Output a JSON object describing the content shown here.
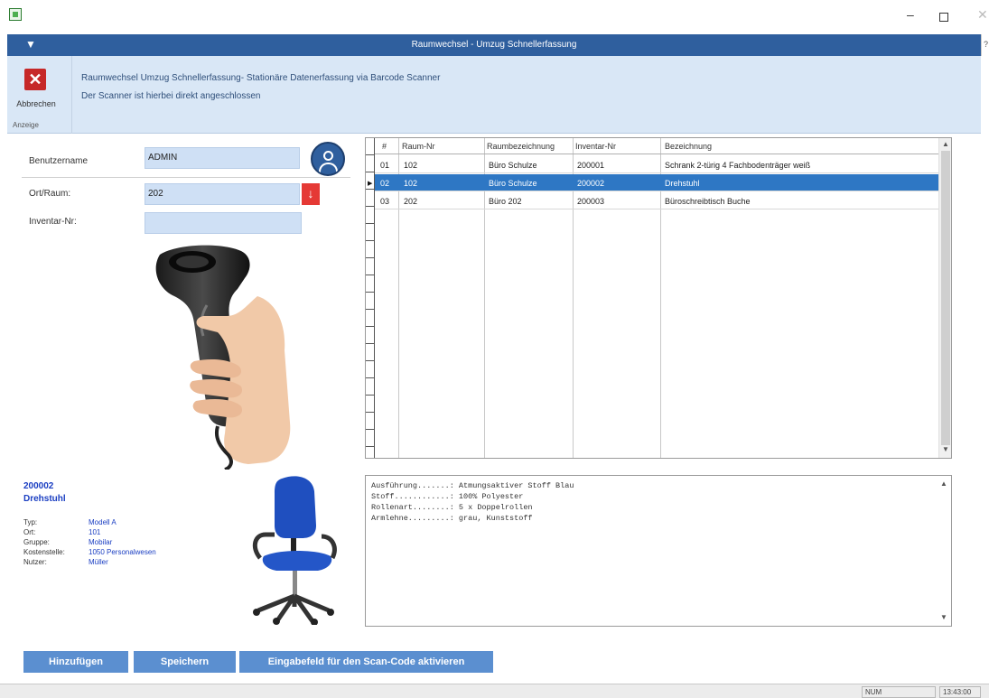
{
  "window": {
    "title": "Raumwechsel - Umzug Schnellerfassung",
    "minimize": "–",
    "close": "✕",
    "menu_glyph": "▼",
    "edge_glyph": "?"
  },
  "ribbon": {
    "cancel_label": "Abbrechen",
    "group_label": "Anzeige",
    "line1": "Raumwechsel Umzug Schnellerfassung-  Stationäre Datenerfassung via Barcode Scanner",
    "line2": "Der Scanner ist hierbei direkt angeschlossen"
  },
  "form": {
    "username_label": "Benutzername",
    "username_value": "ADMIN",
    "room_label": "Ort/Raum:",
    "room_value": "202",
    "inventory_label": "Inventar-Nr:",
    "inventory_value": ""
  },
  "grid": {
    "headers": [
      "#",
      "Raum-Nr",
      "Raumbezeichnung",
      "Inventar-Nr",
      "Bezeichnung"
    ],
    "rows": [
      {
        "nr": "01",
        "room": "102",
        "room_name": "Büro Schulze",
        "inventory": "200001",
        "designation": "Schrank 2-türig 4 Fachbodenträger weiß",
        "selected": false
      },
      {
        "nr": "02",
        "room": "102",
        "room_name": "Büro Schulze",
        "inventory": "200002",
        "designation": "Drehstuhl",
        "selected": true
      },
      {
        "nr": "03",
        "room": "202",
        "room_name": "Büro 202",
        "inventory": "200003",
        "designation": "Büroschreibtisch Buche",
        "selected": false
      }
    ],
    "selection_color": "#2e77c4"
  },
  "item": {
    "id": "200002",
    "name": "Drehstuhl",
    "properties": [
      {
        "key": "Typ:",
        "value": "Modell A"
      },
      {
        "key": "Ort:",
        "value": "101"
      },
      {
        "key": "Gruppe:",
        "value": "Mobilar"
      },
      {
        "key": "Kostenstelle:",
        "value": "1050 Personalwesen"
      },
      {
        "key": "Nutzer:",
        "value": "Müller"
      }
    ]
  },
  "detail": {
    "lines": [
      "Ausführung.......: Atmungsaktiver Stoff Blau",
      "Stoff............: 100% Polyester",
      "Rollenart........: 5 x Doppelrollen",
      "Armlehne.........: grau, Kunststoff"
    ]
  },
  "actions": {
    "add_label": "Hinzufügen",
    "save_label": "Speichern",
    "scan_label": "Eingabefeld für den Scan-Code aktivieren"
  },
  "status": {
    "num": "NUM",
    "time": "13:43:00"
  },
  "icons": {
    "app": "spreadsheet-app-icon",
    "cancel": "close-x-icon",
    "user": "user-avatar-icon",
    "room_arrow": "arrow-down-icon"
  },
  "colors": {
    "title_bar": "#2f5f9e",
    "ribbon_bg": "#d9e7f6",
    "field_bg": "#cfe0f5",
    "accent_red": "#e53935",
    "button_blue": "#5b8fd0",
    "item_text_blue": "#1a3ec2"
  }
}
